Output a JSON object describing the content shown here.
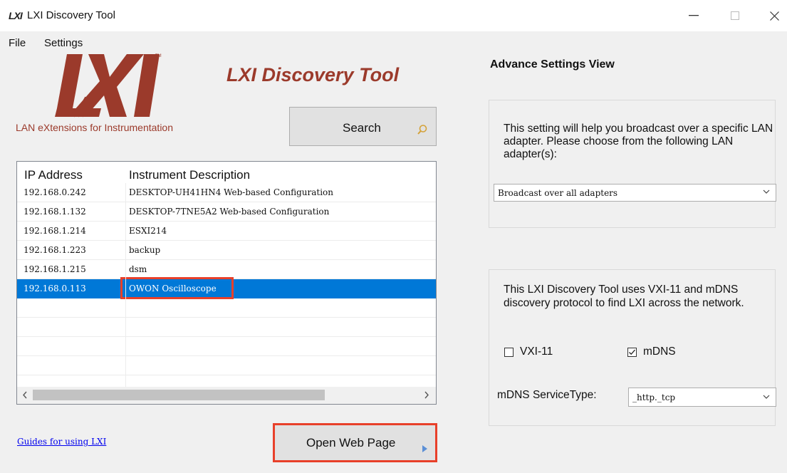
{
  "window": {
    "icon_text": "LXI",
    "title": "LXI Discovery Tool"
  },
  "menu": [
    "File",
    "Settings"
  ],
  "logo": {
    "mark": "LXI",
    "tagline": "LAN eXtensions for Instrumentation"
  },
  "app_heading": "LXI Discovery Tool",
  "search_button": "Search",
  "list": {
    "columns": [
      "IP Address",
      "Instrument Description"
    ],
    "rows": [
      {
        "ip": "192.168.0.242",
        "desc": "DESKTOP-UH41HN4 Web-based Configuration"
      },
      {
        "ip": "192.168.1.132",
        "desc": "DESKTOP-7TNE5A2 Web-based Configuration"
      },
      {
        "ip": "192.168.1.214",
        "desc": "ESXI214"
      },
      {
        "ip": "192.168.1.223",
        "desc": "backup"
      },
      {
        "ip": "192.168.1.215",
        "desc": "dsm"
      },
      {
        "ip": "192.168.0.113",
        "desc": "OWON Oscilloscope"
      }
    ],
    "selected_index": 5
  },
  "guides_link": "Guides for using LXI",
  "open_button": "Open Web Page",
  "advance": {
    "title": "Advance Settings View",
    "adapter_text": "This setting will help you broadcast over a specific LAN adapter. Please choose from the following LAN adapter(s):",
    "adapter_value": "Broadcast over all adapters",
    "protocol_text": "This LXI Discovery Tool uses  VXI-11 and mDNS discovery protocol to find LXI across the network.",
    "vxi_label": "VXI-11",
    "vxi_checked": false,
    "mdns_label": "mDNS",
    "mdns_checked": true,
    "service_label": "mDNS ServiceType:",
    "service_value": "_http._tcp"
  },
  "colors": {
    "brand": "#9b3a2b",
    "selection": "#0078d7",
    "highlight_box": "#e8402a"
  }
}
